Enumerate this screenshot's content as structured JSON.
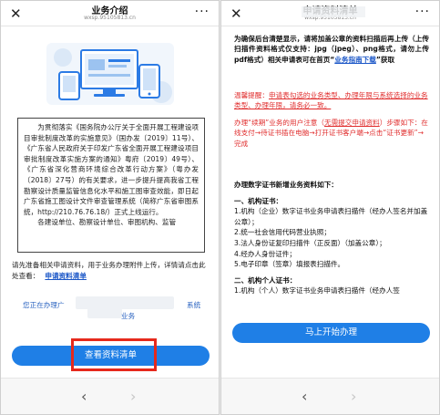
{
  "left": {
    "nav": {
      "title": "业务介绍",
      "url": "wxsp.95105813.cn",
      "close_glyph": "✕",
      "more_glyph": "···"
    },
    "intro_p1": "为贯彻落实《国务院办公厅关于全面开展工程建设项目审批制度改革的实施意见》（国办发〔2019〕11号）、《广东省人民政府关于印发广东省全面开展工程建设项目审批制度改革实施方案的通知》粤府〔2019〕49号）、《广东省深化营商环境综合改革行动方案》（粤办发〔2018〕27号）的有关要求，进一步提升提高我省工程勘察设计质量监管信息化水平和施工图审查效能，即日起广东省施工图设计文件审查管理系统（简称广东省审图系统，http://210.76.76.18/）正式上线运行。",
    "intro_p2": "各建设单位、勘察设计单位、审图机构、监管",
    "upload_note": "请先准备相关申请资料，用于业务办理附件上传，详情请点击此处查看：",
    "upload_link": "申请资料清单",
    "service_prefix": "您正在办理广",
    "service_system": "系统",
    "service_suffix": "业务",
    "button": "查看资料清单",
    "back_glyph": "‹",
    "fwd_glyph": "›"
  },
  "right": {
    "nav": {
      "title": "申请资料清单",
      "url": "wxsp.95105813.cn",
      "close_glyph": "✕",
      "more_glyph": "···"
    },
    "head_a": "为确保后台清楚显示，请将加盖公章的资料扫描后再上传（上传扫描件资料格式仅支持：jpg（jpeg）、png格式，请勿上传pdf格式）相关申请表可在首页“",
    "head_link": "业务指南下载",
    "head_b": "”获取",
    "warn_a": "温馨提醒：",
    "warn_link": "申请表勾选的业务类型、办理年限与系统选择的业务类型、办理年限，请务必一致。",
    "steps_a": "办理“续期”业务的用户注意（",
    "steps_link": "无需提交申请资料",
    "steps_b": "）步骤如下：在线支付→待证书插在电脑→打开证书客户端→点击“证书更新”→完成",
    "body_title": "办理数字证书新增业务资料如下：",
    "sec1_title": "一、机构证书：",
    "sec1_items": [
      "1.机构（企业）数字证书业务申请表扫描件（经办人签名并加盖公章）；",
      "2.统一社会信用代码营业执照；",
      "3.法人身份证复印扫描件（正反面）（加盖公章）；",
      "4.经办人身份证件；",
      "5.电子印章（签章）填报表扫描件。"
    ],
    "sec2_title": "二、机构个人证书：",
    "sec2_items": [
      "1.机构（个人）数字证书业务申请表扫描件（经办人签"
    ],
    "button": "马上开始办理",
    "back_glyph": "‹",
    "fwd_glyph": "›"
  },
  "colors": {
    "primary_button": "#1f7fe6",
    "highlight_box": "#e6291c",
    "link": "#1a56c7",
    "warning": "#e02d2d"
  }
}
